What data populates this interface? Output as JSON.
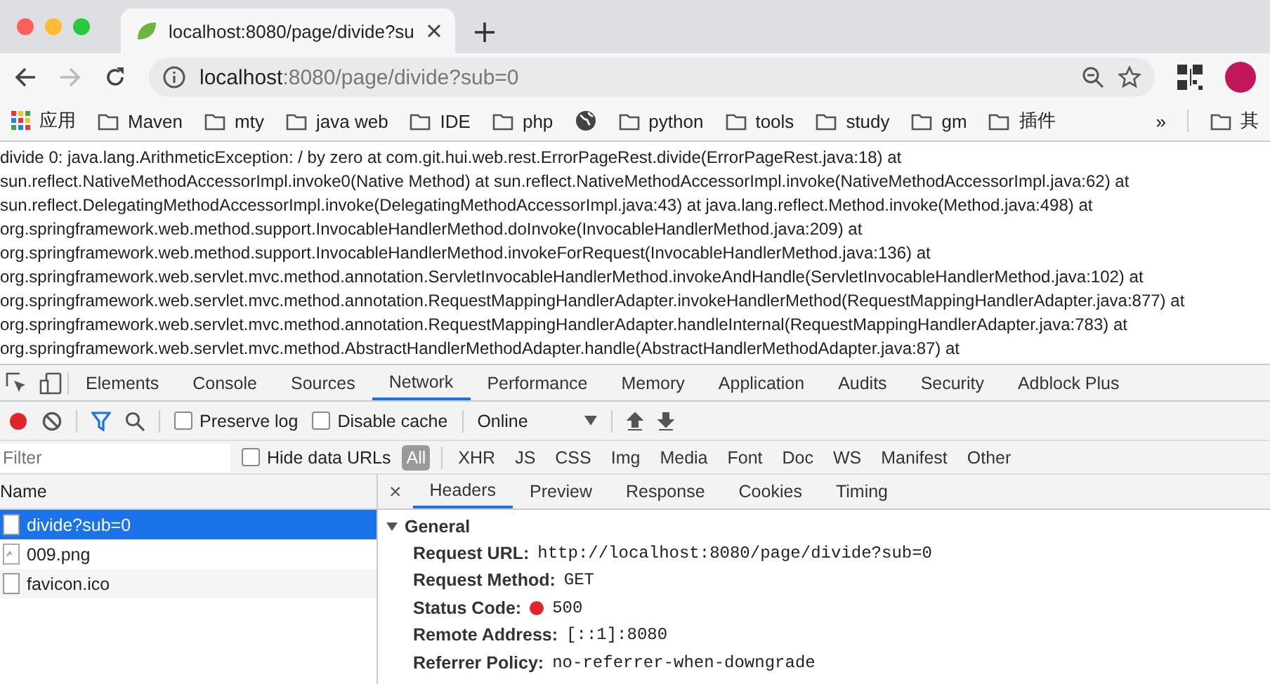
{
  "browser_tab": {
    "title": "localhost:8080/page/divide?su"
  },
  "address_bar": {
    "host": "localhost",
    "path": ":8080/page/divide?sub=0"
  },
  "bookmarks": [
    {
      "kind": "apps",
      "label": "应用"
    },
    {
      "kind": "folder",
      "label": "Maven"
    },
    {
      "kind": "folder",
      "label": "mty"
    },
    {
      "kind": "folder",
      "label": "java web"
    },
    {
      "kind": "folder",
      "label": "IDE"
    },
    {
      "kind": "folder",
      "label": "php"
    },
    {
      "kind": "globe"
    },
    {
      "kind": "folder",
      "label": "python"
    },
    {
      "kind": "folder",
      "label": "tools"
    },
    {
      "kind": "folder",
      "label": "study"
    },
    {
      "kind": "folder",
      "label": "gm"
    },
    {
      "kind": "folder",
      "label": "插件"
    }
  ],
  "bookmarks_more": "»",
  "bookmarks_other": "其",
  "page_text": [
    "divide 0: java.lang.ArithmeticException: / by zero at com.git.hui.web.rest.ErrorPageRest.divide(ErrorPageRest.java:18) at",
    "sun.reflect.NativeMethodAccessorImpl.invoke0(Native Method) at sun.reflect.NativeMethodAccessorImpl.invoke(NativeMethodAccessorImpl.java:62) at",
    "sun.reflect.DelegatingMethodAccessorImpl.invoke(DelegatingMethodAccessorImpl.java:43) at java.lang.reflect.Method.invoke(Method.java:498) at",
    "org.springframework.web.method.support.InvocableHandlerMethod.doInvoke(InvocableHandlerMethod.java:209) at",
    "org.springframework.web.method.support.InvocableHandlerMethod.invokeForRequest(InvocableHandlerMethod.java:136) at",
    "org.springframework.web.servlet.mvc.method.annotation.ServletInvocableHandlerMethod.invokeAndHandle(ServletInvocableHandlerMethod.java:102) at",
    "org.springframework.web.servlet.mvc.method.annotation.RequestMappingHandlerAdapter.invokeHandlerMethod(RequestMappingHandlerAdapter.java:877) at",
    "org.springframework.web.servlet.mvc.method.annotation.RequestMappingHandlerAdapter.handleInternal(RequestMappingHandlerAdapter.java:783) at",
    "org.springframework.web.servlet.mvc.method.AbstractHandlerMethodAdapter.handle(AbstractHandlerMethodAdapter.java:87) at"
  ],
  "devtools": {
    "tabs": [
      {
        "label": "Elements",
        "selected": false
      },
      {
        "label": "Console",
        "selected": false
      },
      {
        "label": "Sources",
        "selected": false
      },
      {
        "label": "Network",
        "selected": true
      },
      {
        "label": "Performance",
        "selected": false
      },
      {
        "label": "Memory",
        "selected": false
      },
      {
        "label": "Application",
        "selected": false
      },
      {
        "label": "Audits",
        "selected": false
      },
      {
        "label": "Security",
        "selected": false
      },
      {
        "label": "Adblock Plus",
        "selected": false
      }
    ],
    "toolbar": {
      "recording": true,
      "preserve_log": {
        "label": "Preserve log",
        "checked": false
      },
      "disable_cache": {
        "label": "Disable cache",
        "checked": false
      },
      "throttling": "Online"
    },
    "filter": {
      "placeholder": "Filter",
      "hide_data_urls": {
        "label": "Hide data URLs",
        "checked": false
      },
      "types": [
        {
          "label": "All",
          "selected": true
        },
        {
          "label": "XHR",
          "selected": false
        },
        {
          "label": "JS",
          "selected": false
        },
        {
          "label": "CSS",
          "selected": false
        },
        {
          "label": "Img",
          "selected": false
        },
        {
          "label": "Media",
          "selected": false
        },
        {
          "label": "Font",
          "selected": false
        },
        {
          "label": "Doc",
          "selected": false
        },
        {
          "label": "WS",
          "selected": false
        },
        {
          "label": "Manifest",
          "selected": false
        },
        {
          "label": "Other",
          "selected": false
        }
      ]
    },
    "requests": {
      "column": "Name",
      "rows": [
        {
          "kind": "document",
          "name": "divide?sub=0",
          "selected": true
        },
        {
          "kind": "image",
          "name": "009.png",
          "selected": false
        },
        {
          "kind": "document",
          "name": "favicon.ico",
          "selected": false
        }
      ]
    },
    "detail": {
      "close": "×",
      "tabs": [
        {
          "label": "Headers",
          "selected": true
        },
        {
          "label": "Preview",
          "selected": false
        },
        {
          "label": "Response",
          "selected": false
        },
        {
          "label": "Cookies",
          "selected": false
        },
        {
          "label": "Timing",
          "selected": false
        }
      ],
      "section": {
        "title": "General",
        "expanded": true,
        "fields": [
          {
            "label": "Request URL:",
            "value": "http://localhost:8080/page/divide?sub=0"
          },
          {
            "label": "Request Method:",
            "value": "GET"
          },
          {
            "label": "Status Code:",
            "value": "500",
            "color": "#e0242b"
          },
          {
            "label": "Remote Address:",
            "value": "[::1]:8080"
          },
          {
            "label": "Referrer Policy:",
            "value": "no-referrer-when-downgrade"
          }
        ]
      }
    }
  }
}
